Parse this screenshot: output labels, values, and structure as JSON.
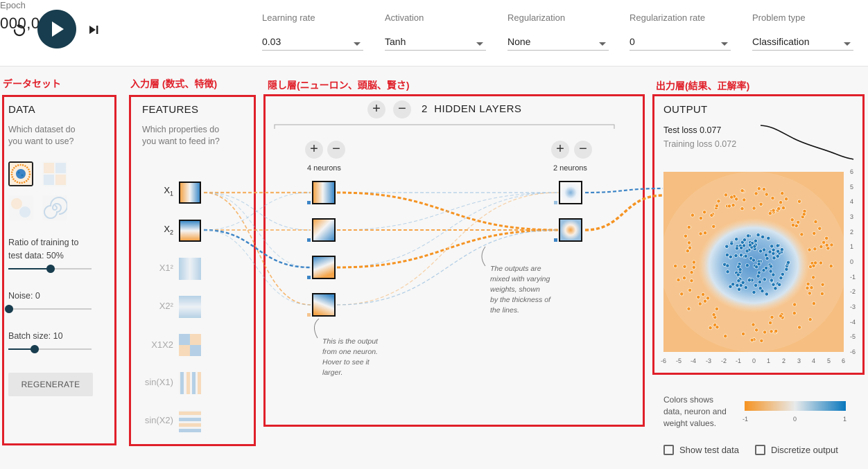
{
  "topbar": {
    "epoch_label": "Epoch",
    "epoch_value": "000,026",
    "fields": [
      {
        "label": "Learning rate",
        "value": "0.03"
      },
      {
        "label": "Activation",
        "value": "Tanh"
      },
      {
        "label": "Regularization",
        "value": "None"
      },
      {
        "label": "Regularization rate",
        "value": "0"
      },
      {
        "label": "Problem type",
        "value": "Classification"
      }
    ]
  },
  "annotations": {
    "dataset": "データセット",
    "input_layer": "入力層 (数式、特徴)",
    "hidden_layer": "隠し層(ニューロン、頭脳、賢さ)",
    "output_layer": "出力層(結果、正解率)"
  },
  "data": {
    "title": "DATA",
    "subtitle_1": "Which dataset do",
    "subtitle_2": "you want to use?",
    "ratio_label_1": "Ratio of training to",
    "ratio_label_2": "test data:  50%",
    "ratio_value": 50,
    "noise_label": "Noise:  0",
    "noise_value": 0,
    "batch_label": "Batch size:  10",
    "batch_value": 10,
    "regenerate": "REGENERATE"
  },
  "features": {
    "title": "FEATURES",
    "subtitle_1": "Which properties do",
    "subtitle_2": "you want to feed in?",
    "items": [
      {
        "label": "X1",
        "sub": "1",
        "base": "X",
        "active": true
      },
      {
        "label": "X2",
        "sub": "2",
        "base": "X",
        "active": true
      },
      {
        "label": "X1²",
        "active": false
      },
      {
        "label": "X2²",
        "active": false
      },
      {
        "label": "X1X2",
        "active": false
      },
      {
        "label": "sin(X1)",
        "active": false
      },
      {
        "label": "sin(X2)",
        "active": false
      }
    ]
  },
  "hidden": {
    "count": "2",
    "title": "HIDDEN LAYERS",
    "layer1_label": "4 neurons",
    "layer2_label": "2 neurons",
    "note_neuron": [
      "This is the output",
      "from one neuron.",
      "Hover to see it",
      "larger."
    ],
    "note_weights": [
      "The outputs are",
      "mixed with varying",
      "weights, shown",
      "by the thickness of",
      "the lines."
    ]
  },
  "output": {
    "title": "OUTPUT",
    "test_loss": "Test loss 0.077",
    "training_loss": "Training loss 0.072",
    "y_ticks": [
      "6",
      "5",
      "4",
      "3",
      "2",
      "1",
      "0",
      "-1",
      "-2",
      "-3",
      "-4",
      "-5",
      "-6"
    ],
    "x_ticks": [
      "-6",
      "-5",
      "-4",
      "-3",
      "-2",
      "-1",
      "0",
      "1",
      "2",
      "3",
      "4",
      "5",
      "6"
    ],
    "legend_text_1": "Colors shows",
    "legend_text_2": "data, neuron and",
    "legend_text_3": "weight values.",
    "legend_ticks": [
      "-1",
      "0",
      "1"
    ],
    "show_test_data": "Show test data",
    "discretize_output": "Discretize output"
  },
  "colors": {
    "positive": "#1f77b4",
    "negative": "#f59322",
    "dark": "#183d4e",
    "annotation": "#e0202a"
  }
}
